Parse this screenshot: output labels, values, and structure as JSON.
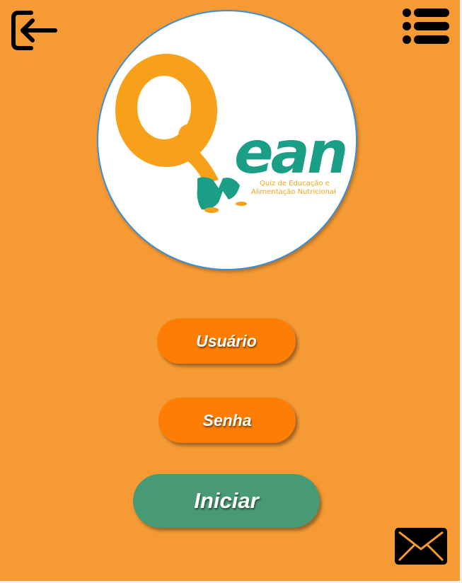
{
  "header": {
    "exit_icon": "exit-arrow-icon",
    "menu_icon": "list-menu-icon"
  },
  "logo": {
    "wordmark": "ean",
    "tagline_line1": "Quiz de Educação e",
    "tagline_line2": "Alimentação Nutricional",
    "colors": {
      "orange": "#f7a01a",
      "green": "#1a9e86"
    }
  },
  "form": {
    "user_label": "Usuário",
    "password_label": "Senha",
    "start_label": "Iniciar"
  },
  "footer": {
    "mail_icon": "envelope-icon"
  },
  "colors": {
    "background": "#f59a35",
    "field": "#fd7d05",
    "start": "#479a74",
    "icon": "#000000"
  }
}
